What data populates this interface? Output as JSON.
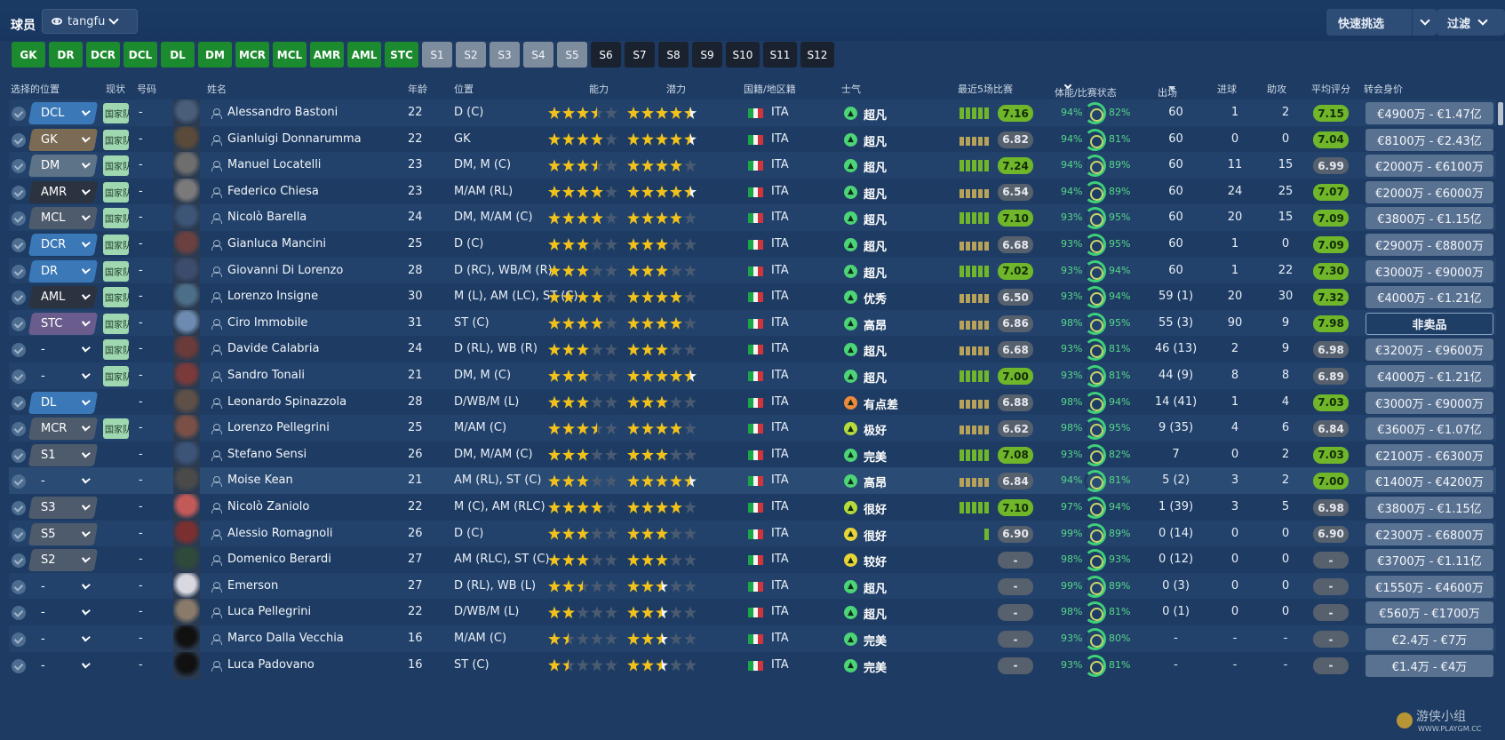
{
  "header": {
    "title": "球员",
    "view_name": "tangfu",
    "quick_pick": "快速挑选",
    "filter": "过滤"
  },
  "position_buttons": [
    {
      "label": "GK",
      "style": "green"
    },
    {
      "label": "DR",
      "style": "green"
    },
    {
      "label": "DCR",
      "style": "green"
    },
    {
      "label": "DCL",
      "style": "green"
    },
    {
      "label": "DL",
      "style": "green"
    },
    {
      "label": "DM",
      "style": "green"
    },
    {
      "label": "MCR",
      "style": "green"
    },
    {
      "label": "MCL",
      "style": "green"
    },
    {
      "label": "AMR",
      "style": "green"
    },
    {
      "label": "AML",
      "style": "green"
    },
    {
      "label": "STC",
      "style": "green"
    },
    {
      "label": "S1",
      "style": "grey"
    },
    {
      "label": "S2",
      "style": "grey"
    },
    {
      "label": "S3",
      "style": "grey"
    },
    {
      "label": "S4",
      "style": "grey"
    },
    {
      "label": "S5",
      "style": "grey"
    },
    {
      "label": "S6",
      "style": "dark"
    },
    {
      "label": "S7",
      "style": "dark"
    },
    {
      "label": "S8",
      "style": "dark"
    },
    {
      "label": "S9",
      "style": "dark"
    },
    {
      "label": "S10",
      "style": "dark"
    },
    {
      "label": "S11",
      "style": "dark"
    },
    {
      "label": "S12",
      "style": "dark"
    }
  ],
  "columns": {
    "selected_position": "选择的位置",
    "status": "现状",
    "number": "号码",
    "name": "姓名",
    "age": "年龄",
    "position": "位置",
    "ability": "能力",
    "potential": "潜力",
    "nationality": "国籍/地区籍",
    "morale": "士气",
    "last5": "最近5场比赛",
    "condition": "体能/比赛状态",
    "apps": "出场",
    "goals": "进球",
    "assists": "助攻",
    "avg_rating": "平均评分",
    "value": "转会身价"
  },
  "colors": {
    "pos_blue": "#3a78b8",
    "pos_brown": "#7b6a54",
    "pos_steel": "#5d7387",
    "pos_dark": "#2c3340",
    "pos_grey": "#4e5b6c",
    "pos_purple": "#6a5c8c",
    "star_gold": "#f2c21b",
    "star_empty": "#4a5a70",
    "rating_green": "#6fb62a",
    "rating_grey": "#57606d",
    "flag_green": "#1aa548",
    "flag_white": "#f4f4f4",
    "flag_red": "#d3343c",
    "morale_superb": "#4cd477",
    "morale_good": "#b7db3a",
    "morale_ok": "#e9d438",
    "morale_low": "#f08a3a"
  },
  "players": [
    {
      "sel": "DCL",
      "sel_color": "pos_blue",
      "status": "国家队",
      "num": "-",
      "avatar": "#4a5e7a",
      "name": "Alessandro Bastoni",
      "age": "22",
      "pos": "D (C)",
      "ca": 3.5,
      "pa": 4.5,
      "nat": "ITA",
      "morale": "超凡",
      "mo_color": "morale_superb",
      "bars": [
        1,
        1,
        1,
        1,
        1
      ],
      "bar_colors": "gggg",
      "last5": "7.16",
      "last5_green": true,
      "cond": "94%",
      "fit": "82%",
      "apps": "60",
      "goals": "1",
      "assists": "2",
      "avg": "7.15",
      "avg_green": true,
      "value": "€4900万 - €1.47亿"
    },
    {
      "sel": "GK",
      "sel_color": "pos_brown",
      "status": "国家队",
      "num": "-",
      "avatar": "#5a4a3a",
      "name": "Gianluigi Donnarumma",
      "age": "22",
      "pos": "GK",
      "ca": 4,
      "pa": 4.5,
      "nat": "ITA",
      "morale": "超凡",
      "mo_color": "morale_superb",
      "bars": [
        1,
        1,
        1,
        1,
        1
      ],
      "bar_colors": "ooo",
      "last5": "6.82",
      "last5_green": false,
      "cond": "94%",
      "fit": "81%",
      "apps": "60",
      "goals": "0",
      "assists": "0",
      "avg": "7.04",
      "avg_green": true,
      "value": "€8100万 - €2.43亿"
    },
    {
      "sel": "DM",
      "sel_color": "pos_steel",
      "status": "国家队",
      "num": "-",
      "avatar": "#6e6e6e",
      "name": "Manuel Locatelli",
      "age": "23",
      "pos": "DM, M (C)",
      "ca": 3.5,
      "pa": 4,
      "nat": "ITA",
      "morale": "超凡",
      "mo_color": "morale_superb",
      "bars": [
        1,
        1,
        1,
        1,
        1
      ],
      "bar_colors": "ggggg",
      "last5": "7.24",
      "last5_green": true,
      "cond": "94%",
      "fit": "89%",
      "apps": "60",
      "goals": "11",
      "assists": "15",
      "avg": "6.99",
      "avg_green": false,
      "value": "€2000万 - €6100万"
    },
    {
      "sel": "AMR",
      "sel_color": "pos_dark",
      "status": "国家队",
      "num": "-",
      "avatar": "#7a7a7a",
      "name": "Federico Chiesa",
      "age": "23",
      "pos": "M/AM (RL)",
      "ca": 4,
      "pa": 4.5,
      "nat": "ITA",
      "morale": "超凡",
      "mo_color": "morale_superb",
      "bars": [
        1,
        1,
        1,
        1,
        1
      ],
      "bar_colors": "oooo",
      "last5": "6.54",
      "last5_green": false,
      "cond": "94%",
      "fit": "89%",
      "apps": "60",
      "goals": "24",
      "assists": "25",
      "avg": "7.07",
      "avg_green": true,
      "value": "€2000万 - €6000万"
    },
    {
      "sel": "MCL",
      "sel_color": "pos_grey",
      "status": "国家队",
      "num": "-",
      "avatar": "#3d5577",
      "name": "Nicolò Barella",
      "age": "24",
      "pos": "DM, M/AM (C)",
      "ca": 4,
      "pa": 4,
      "nat": "ITA",
      "morale": "超凡",
      "mo_color": "morale_superb",
      "bars": [
        1,
        1,
        1,
        1,
        1
      ],
      "bar_colors": "ggggg",
      "last5": "7.10",
      "last5_green": true,
      "cond": "93%",
      "fit": "95%",
      "apps": "60",
      "goals": "20",
      "assists": "15",
      "avg": "7.09",
      "avg_green": true,
      "value": "€3800万 - €1.15亿"
    },
    {
      "sel": "DCR",
      "sel_color": "pos_blue",
      "status": "国家队",
      "num": "-",
      "avatar": "#6b4040",
      "name": "Gianluca Mancini",
      "age": "25",
      "pos": "D (C)",
      "ca": 3,
      "pa": 3,
      "nat": "ITA",
      "morale": "超凡",
      "mo_color": "morale_superb",
      "bars": [
        1,
        1,
        1,
        1,
        1
      ],
      "bar_colors": "ooooo",
      "last5": "6.68",
      "last5_green": false,
      "cond": "93%",
      "fit": "95%",
      "apps": "60",
      "goals": "1",
      "assists": "0",
      "avg": "7.09",
      "avg_green": true,
      "value": "€2900万 - €8800万"
    },
    {
      "sel": "DR",
      "sel_color": "pos_blue",
      "status": "国家队",
      "num": "-",
      "avatar": "#3c4c6c",
      "name": "Giovanni Di Lorenzo",
      "age": "28",
      "pos": "D (RC), WB/M (R)",
      "ca": 3,
      "pa": 3,
      "nat": "ITA",
      "morale": "超凡",
      "mo_color": "morale_superb",
      "bars": [
        1,
        1,
        1,
        1,
        1
      ],
      "bar_colors": "ggggg",
      "last5": "7.02",
      "last5_green": true,
      "cond": "93%",
      "fit": "94%",
      "apps": "60",
      "goals": "1",
      "assists": "22",
      "avg": "7.30",
      "avg_green": true,
      "value": "€3000万 - €9000万"
    },
    {
      "sel": "AML",
      "sel_color": "pos_dark",
      "status": "国家队",
      "num": "-",
      "avatar": "#4d6e88",
      "name": "Lorenzo Insigne",
      "age": "30",
      "pos": "M (L), AM (LC), ST (C)",
      "ca": 4,
      "pa": 4,
      "nat": "ITA",
      "morale": "优秀",
      "mo_color": "morale_superb",
      "bars": [
        1,
        1,
        1,
        1,
        1
      ],
      "bar_colors": "oooo",
      "last5": "6.50",
      "last5_green": false,
      "cond": "93%",
      "fit": "94%",
      "apps": "59 (1)",
      "goals": "20",
      "assists": "30",
      "avg": "7.32",
      "avg_green": true,
      "value": "€4000万 - €1.21亿"
    },
    {
      "sel": "STC",
      "sel_color": "pos_purple",
      "status": "国家队",
      "num": "-",
      "avatar": "#6d8bb0",
      "name": "Ciro Immobile",
      "age": "31",
      "pos": "ST (C)",
      "ca": 4,
      "pa": 4,
      "nat": "ITA",
      "morale": "高昂",
      "mo_color": "morale_superb",
      "bars": [
        1,
        1,
        1,
        1,
        1
      ],
      "bar_colors": "ooooo",
      "last5": "6.86",
      "last5_green": false,
      "cond": "98%",
      "fit": "95%",
      "apps": "55 (3)",
      "goals": "90",
      "assists": "9",
      "avg": "7.98",
      "avg_green": true,
      "value": "非卖品",
      "nfs": true
    },
    {
      "sel": "-",
      "sel_color": "",
      "status": "国家队",
      "num": "-",
      "avatar": "#6b3a3a",
      "name": "Davide Calabria",
      "age": "24",
      "pos": "D (RL), WB (R)",
      "ca": 3,
      "pa": 3,
      "nat": "ITA",
      "morale": "超凡",
      "mo_color": "morale_superb",
      "bars": [
        1,
        1,
        1,
        1,
        1
      ],
      "bar_colors": "ooooo",
      "last5": "6.68",
      "last5_green": false,
      "cond": "93%",
      "fit": "81%",
      "apps": "46 (13)",
      "goals": "2",
      "assists": "9",
      "avg": "6.98",
      "avg_green": false,
      "value": "€3200万 - €9600万"
    },
    {
      "sel": "-",
      "sel_color": "",
      "status": "国家队",
      "num": "-",
      "avatar": "#7a3a3a",
      "name": "Sandro Tonali",
      "age": "21",
      "pos": "DM, M (C)",
      "ca": 3,
      "pa": 4.5,
      "nat": "ITA",
      "morale": "超凡",
      "mo_color": "morale_superb",
      "bars": [
        1,
        1,
        1,
        1,
        1
      ],
      "bar_colors": "ggggg",
      "last5": "7.00",
      "last5_green": true,
      "cond": "93%",
      "fit": "81%",
      "apps": "44 (9)",
      "goals": "8",
      "assists": "8",
      "avg": "6.89",
      "avg_green": false,
      "value": "€4000万 - €1.21亿"
    },
    {
      "sel": "DL",
      "sel_color": "pos_blue",
      "status": "",
      "num": "-",
      "avatar": "#5e5046",
      "name": "Leonardo Spinazzola",
      "age": "28",
      "pos": "D/WB/M (L)",
      "ca": 3,
      "pa": 3,
      "nat": "ITA",
      "morale": "有点差",
      "mo_color": "morale_low",
      "bars": [
        1,
        1,
        1,
        1,
        1
      ],
      "bar_colors": "ooooo",
      "last5": "6.88",
      "last5_green": false,
      "cond": "98%",
      "fit": "94%",
      "apps": "14 (41)",
      "goals": "1",
      "assists": "4",
      "avg": "7.03",
      "avg_green": true,
      "value": "€3000万 - €9000万"
    },
    {
      "sel": "MCR",
      "sel_color": "pos_grey",
      "status": "国家队",
      "num": "-",
      "avatar": "#7a5046",
      "name": "Lorenzo Pellegrini",
      "age": "25",
      "pos": "M/AM (C)",
      "ca": 3.5,
      "pa": 4,
      "nat": "ITA",
      "morale": "极好",
      "mo_color": "morale_good",
      "bars": [
        1,
        1,
        1,
        1,
        1
      ],
      "bar_colors": "ooooo",
      "last5": "6.62",
      "last5_green": false,
      "cond": "98%",
      "fit": "95%",
      "apps": "9 (35)",
      "goals": "4",
      "assists": "6",
      "avg": "6.84",
      "avg_green": false,
      "value": "€3600万 - €1.07亿"
    },
    {
      "sel": "S1",
      "sel_color": "pos_grey",
      "status": "",
      "num": "-",
      "avatar": "#3c5478",
      "name": "Stefano Sensi",
      "age": "26",
      "pos": "DM, M/AM (C)",
      "ca": 3,
      "pa": 3,
      "nat": "ITA",
      "morale": "完美",
      "mo_color": "morale_superb",
      "bars": [
        1,
        1,
        1,
        1,
        1
      ],
      "bar_colors": "ggggg",
      "last5": "7.08",
      "last5_green": true,
      "cond": "93%",
      "fit": "82%",
      "apps": "7",
      "goals": "0",
      "assists": "2",
      "avg": "7.03",
      "avg_green": true,
      "value": "€2100万 - €6300万"
    },
    {
      "sel": "-",
      "sel_color": "",
      "status": "",
      "num": "-",
      "avatar": "#4a4a4a",
      "name": "Moise Kean",
      "age": "21",
      "pos": "AM (RL), ST (C)",
      "ca": 3,
      "pa": 4.5,
      "nat": "ITA",
      "morale": "高昂",
      "mo_color": "morale_superb",
      "bars": [
        1,
        1,
        1,
        1,
        1
      ],
      "bar_colors": "ooooo",
      "last5": "6.84",
      "last5_green": false,
      "cond": "94%",
      "fit": "81%",
      "apps": "5 (2)",
      "goals": "3",
      "assists": "2",
      "avg": "7.00",
      "avg_green": true,
      "value": "€1400万 - €4200万",
      "hl": true
    },
    {
      "sel": "S3",
      "sel_color": "pos_grey",
      "status": "",
      "num": "-",
      "avatar": "#c25a5a",
      "name": "Nicolò Zaniolo",
      "age": "22",
      "pos": "M (C), AM (RLC)",
      "ca": 4,
      "pa": 4,
      "nat": "ITA",
      "morale": "很好",
      "mo_color": "morale_good",
      "bars": [
        1,
        1,
        1,
        1,
        1
      ],
      "bar_colors": "ggggg",
      "last5": "7.10",
      "last5_green": true,
      "cond": "97%",
      "fit": "94%",
      "apps": "1 (39)",
      "goals": "3",
      "assists": "5",
      "avg": "6.98",
      "avg_green": false,
      "value": "€3800万 - €1.15亿"
    },
    {
      "sel": "S5",
      "sel_color": "pos_grey",
      "status": "",
      "num": "-",
      "avatar": "#7a3030",
      "name": "Alessio Romagnoli",
      "age": "26",
      "pos": "D (C)",
      "ca": 3,
      "pa": 3,
      "nat": "ITA",
      "morale": "很好",
      "mo_color": "morale_ok",
      "bars": [
        1
      ],
      "bar_colors": "g",
      "last5": "6.90",
      "last5_green": false,
      "cond": "99%",
      "fit": "89%",
      "apps": "0 (14)",
      "goals": "0",
      "assists": "0",
      "avg": "6.90",
      "avg_green": false,
      "value": "€2300万 - €6800万"
    },
    {
      "sel": "S2",
      "sel_color": "pos_grey",
      "status": "",
      "num": "-",
      "avatar": "#2e4a3a",
      "name": "Domenico Berardi",
      "age": "27",
      "pos": "AM (RLC), ST (C)",
      "ca": 3,
      "pa": 3,
      "nat": "ITA",
      "morale": "较好",
      "mo_color": "morale_ok",
      "bars": [],
      "bar_colors": "",
      "last5": "-",
      "last5_green": false,
      "cond": "98%",
      "fit": "93%",
      "apps": "0 (12)",
      "goals": "0",
      "assists": "0",
      "avg": "-",
      "avg_green": false,
      "value": "€3700万 - €1.11亿"
    },
    {
      "sel": "-",
      "sel_color": "",
      "status": "",
      "num": "-",
      "avatar": "#d8d8e0",
      "name": "Emerson",
      "age": "27",
      "pos": "D (RL), WB (L)",
      "ca": 2.5,
      "pa": 2.5,
      "nat": "ITA",
      "morale": "超凡",
      "mo_color": "morale_superb",
      "bars": [],
      "bar_colors": "",
      "last5": "-",
      "last5_green": false,
      "cond": "99%",
      "fit": "89%",
      "apps": "0 (3)",
      "goals": "0",
      "assists": "0",
      "avg": "-",
      "avg_green": false,
      "value": "€1550万 - €4600万"
    },
    {
      "sel": "-",
      "sel_color": "",
      "status": "",
      "num": "-",
      "avatar": "#8a7a6a",
      "name": "Luca Pellegrini",
      "age": "22",
      "pos": "D/WB/M (L)",
      "ca": 2,
      "pa": 2.5,
      "nat": "ITA",
      "morale": "超凡",
      "mo_color": "morale_superb",
      "bars": [],
      "bar_colors": "",
      "last5": "-",
      "last5_green": false,
      "cond": "98%",
      "fit": "81%",
      "apps": "0 (1)",
      "goals": "0",
      "assists": "0",
      "avg": "-",
      "avg_green": false,
      "value": "€560万 - €1700万"
    },
    {
      "sel": "-",
      "sel_color": "",
      "status": "",
      "num": "-",
      "avatar": "#111111",
      "name": "Marco Dalla Vecchia",
      "age": "16",
      "pos": "M/AM (C)",
      "ca": 1.5,
      "pa": 2.5,
      "nat": "ITA",
      "morale": "完美",
      "mo_color": "morale_superb",
      "bars": [],
      "bar_colors": "",
      "last5": "-",
      "last5_green": false,
      "cond": "93%",
      "fit": "80%",
      "apps": "-",
      "goals": "-",
      "assists": "-",
      "avg": "-",
      "avg_green": false,
      "value": "€2.4万 - €7万"
    },
    {
      "sel": "-",
      "sel_color": "",
      "status": "",
      "num": "-",
      "avatar": "#111111",
      "name": "Luca Padovano",
      "age": "16",
      "pos": "ST (C)",
      "ca": 1.5,
      "pa": 2.5,
      "nat": "ITA",
      "morale": "完美",
      "mo_color": "morale_superb",
      "bars": [],
      "bar_colors": "",
      "last5": "-",
      "last5_green": false,
      "cond": "93%",
      "fit": "81%",
      "apps": "-",
      "goals": "-",
      "assists": "-",
      "avg": "-",
      "avg_green": false,
      "value": "€1.4万 - €4万"
    }
  ],
  "watermark": {
    "text": "游侠小组",
    "url": "WWW.PLAYGM.CC"
  }
}
